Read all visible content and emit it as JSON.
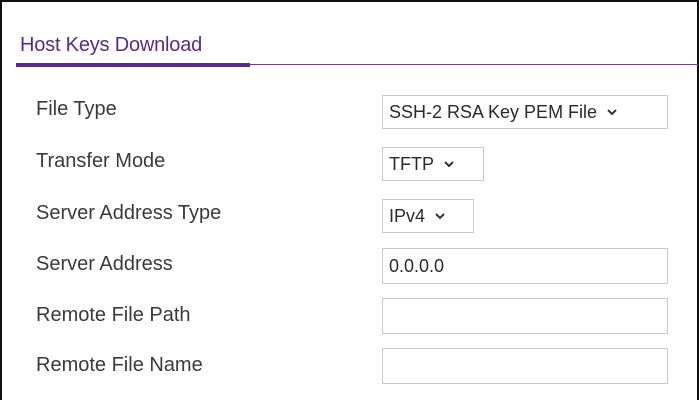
{
  "panel": {
    "title": "Host Keys Download"
  },
  "icons": {
    "dropdown": "chevron-down-icon"
  },
  "colors": {
    "title": "#5a2a8a",
    "rule": "#6e3fa0",
    "label": "#3a3a3a",
    "field_border": "#c8c8c8"
  },
  "fields": {
    "file_type": {
      "label": "File Type",
      "value": "SSH-2 RSA Key PEM File"
    },
    "transfer_mode": {
      "label": "Transfer Mode",
      "value": "TFTP"
    },
    "server_address_type": {
      "label": "Server Address Type",
      "value": "IPv4"
    },
    "server_address": {
      "label": "Server Address",
      "value": "0.0.0.0"
    },
    "remote_file_path": {
      "label": "Remote File Path",
      "value": ""
    },
    "remote_file_name": {
      "label": "Remote File Name",
      "value": ""
    }
  }
}
